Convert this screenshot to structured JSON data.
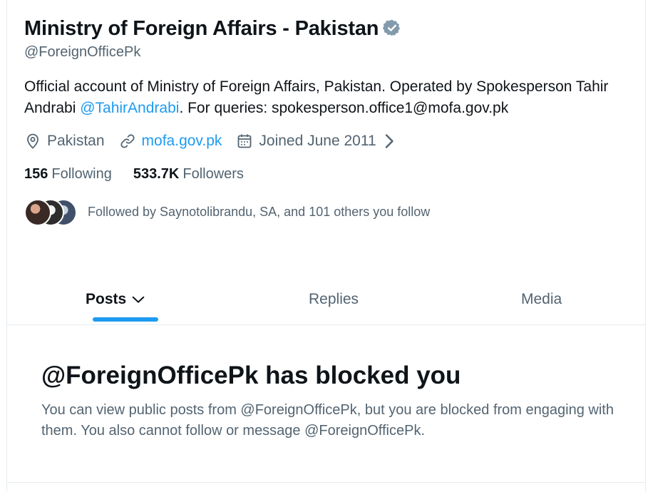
{
  "profile": {
    "display_name": "Ministry of Foreign Affairs - Pakistan",
    "handle": "@ForeignOfficePk",
    "verified_icon": "verified-badge-icon",
    "bio": {
      "part1": "Official account of Ministry of Foreign Affairs, Pakistan. Operated by Spokesperson Tahir Andrabi ",
      "mention": "@TahirAndrabi",
      "part2": ". For queries: spokesperson.office1@mofa.gov.pk"
    },
    "location": "Pakistan",
    "website": "mofa.gov.pk",
    "joined": "Joined June 2011",
    "following_count": "156",
    "following_label": "Following",
    "followers_count": "533.7K",
    "followers_label": "Followers",
    "followed_by": "Followed by Saynotolibrandu, SA, and 101 others you follow"
  },
  "tabs": [
    {
      "label": "Posts",
      "active": true
    },
    {
      "label": "Replies",
      "active": false
    },
    {
      "label": "Media",
      "active": false
    }
  ],
  "blocked": {
    "title": "@ForeignOfficePk has blocked you",
    "body": "You can view public posts from @ForeignOfficePk, but you are blocked from engaging with them. You also cannot follow or message @ForeignOfficePk."
  },
  "colors": {
    "accent": "#1d9bf0",
    "text_primary": "#0f1419",
    "text_secondary": "#536471",
    "border": "#e6ecf0",
    "verified": "#829aab"
  }
}
